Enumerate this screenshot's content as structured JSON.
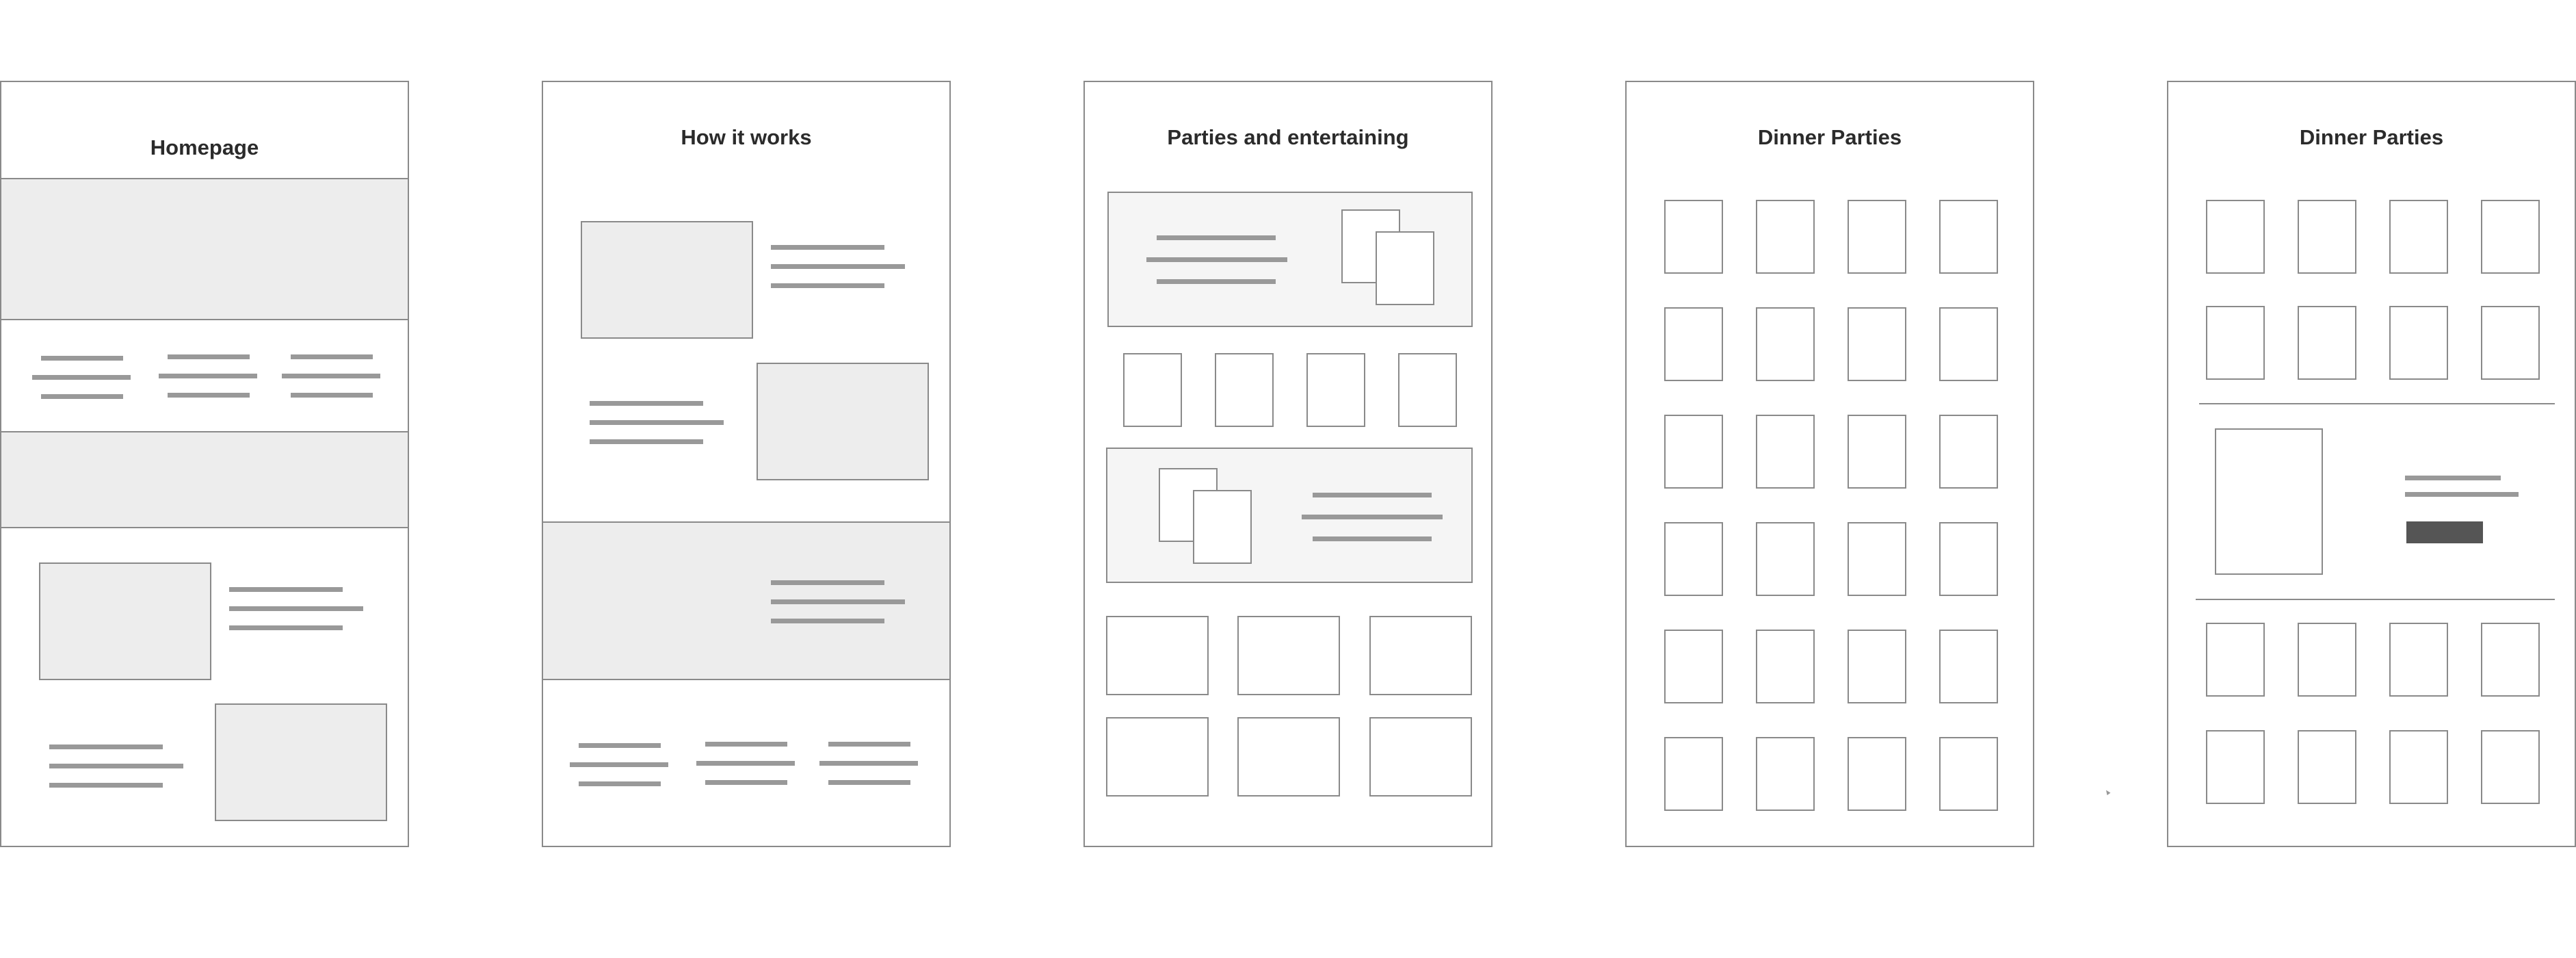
{
  "frames": [
    {
      "title": "Homepage"
    },
    {
      "title": "How it works"
    },
    {
      "title": "Parties and entertaining"
    },
    {
      "title": "Dinner Parties"
    },
    {
      "title": "Dinner Parties"
    }
  ]
}
